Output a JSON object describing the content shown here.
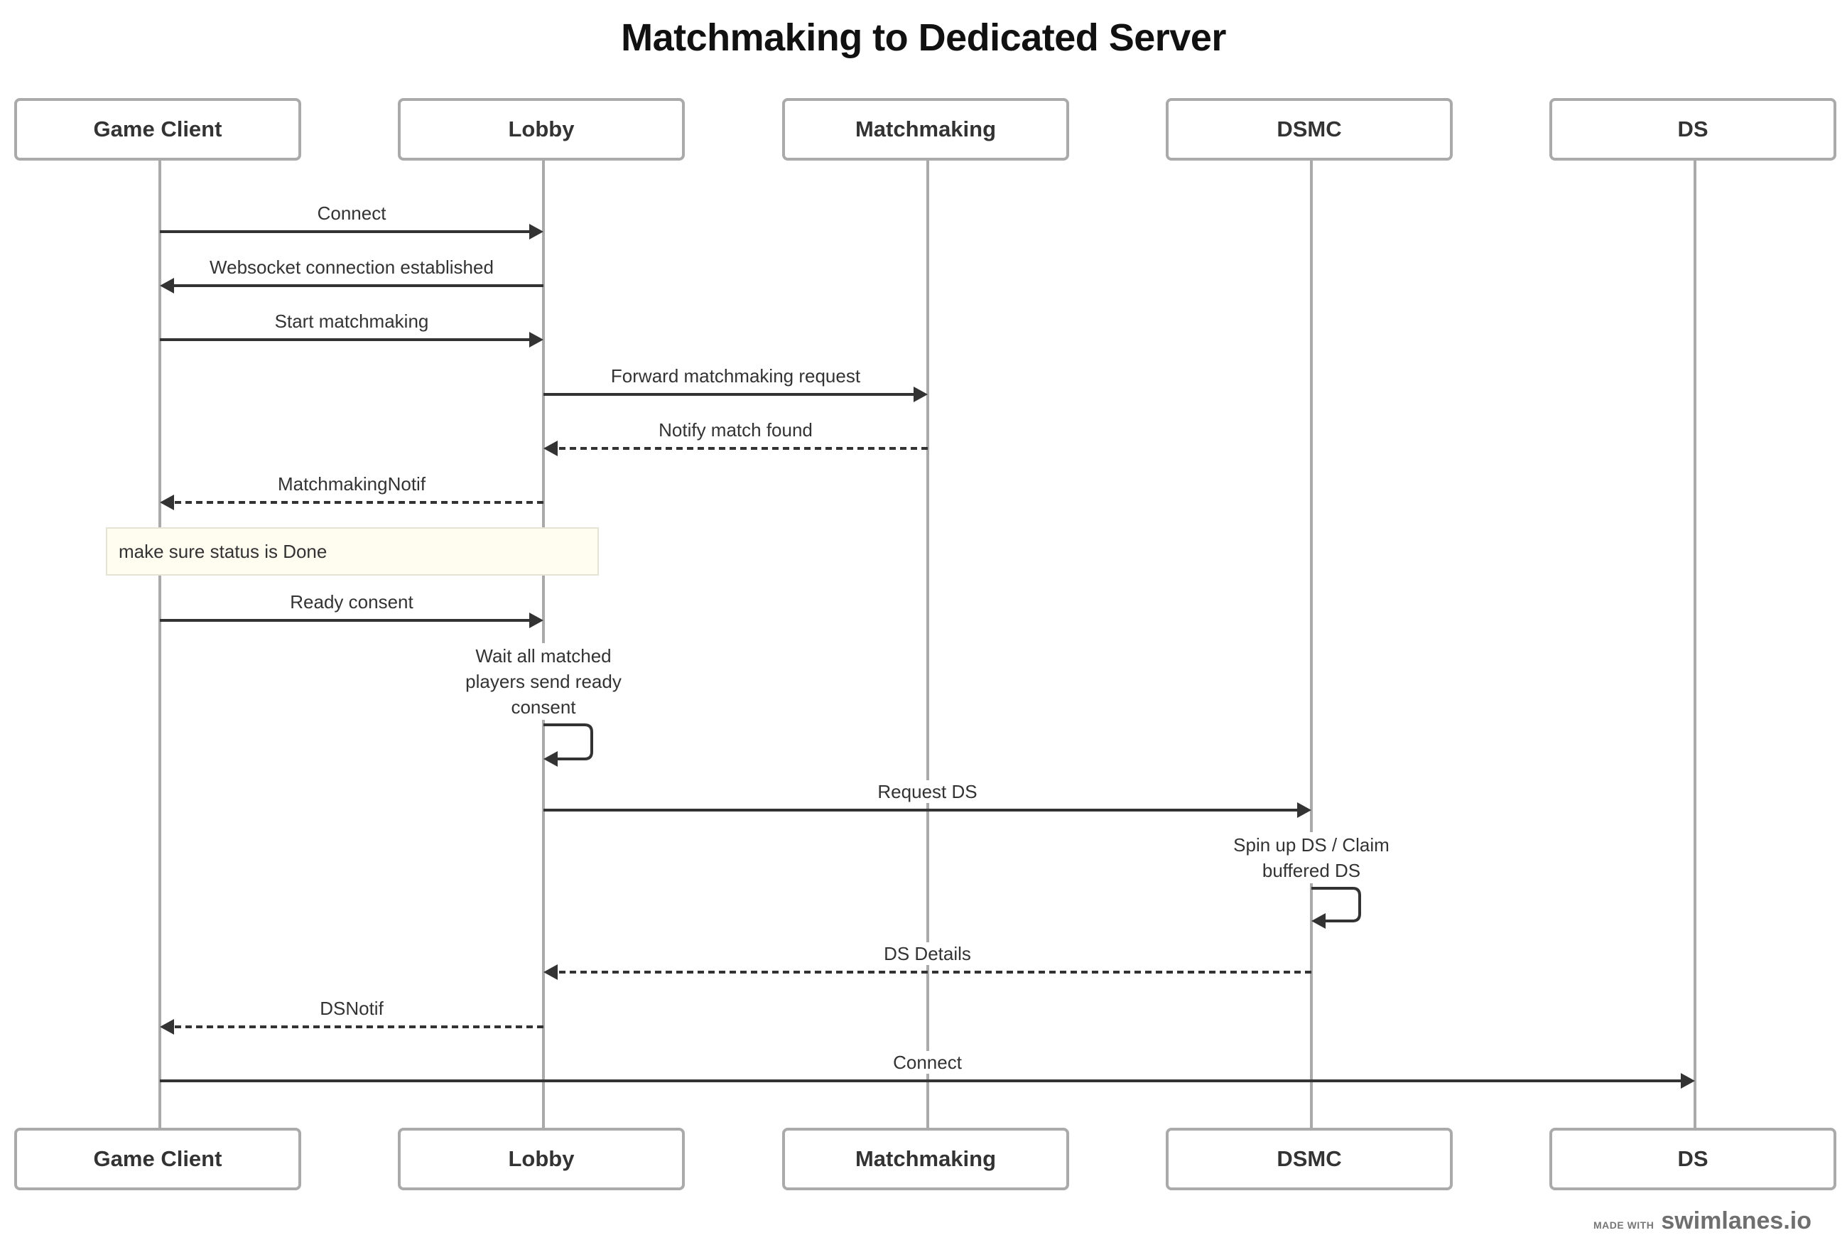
{
  "title": "Matchmaking to Dedicated Server",
  "actors": [
    {
      "id": "game-client",
      "label": "Game Client"
    },
    {
      "id": "lobby",
      "label": "Lobby"
    },
    {
      "id": "matchmaking",
      "label": "Matchmaking"
    },
    {
      "id": "dsmc",
      "label": "DSMC"
    },
    {
      "id": "ds",
      "label": "DS"
    }
  ],
  "steps": [
    {
      "type": "message",
      "from": 0,
      "to": 1,
      "label": "Connect",
      "style": "solid"
    },
    {
      "type": "message",
      "from": 1,
      "to": 0,
      "label": "Websocket connection established",
      "style": "solid"
    },
    {
      "type": "message",
      "from": 0,
      "to": 1,
      "label": "Start matchmaking",
      "style": "solid"
    },
    {
      "type": "message",
      "from": 1,
      "to": 2,
      "label": "Forward matchmaking request",
      "style": "solid"
    },
    {
      "type": "message",
      "from": 2,
      "to": 1,
      "label": "Notify match found",
      "style": "dashed"
    },
    {
      "type": "message",
      "from": 1,
      "to": 0,
      "label": "MatchmakingNotif",
      "style": "dashed"
    },
    {
      "type": "note",
      "over": [
        0,
        1
      ],
      "label": "make sure status is Done"
    },
    {
      "type": "message",
      "from": 0,
      "to": 1,
      "label": "Ready consent",
      "style": "solid"
    },
    {
      "type": "self",
      "actor": 1,
      "label": "Wait all matched players send ready consent",
      "lines": [
        "Wait all matched",
        "players send ready",
        "consent"
      ]
    },
    {
      "type": "message",
      "from": 1,
      "to": 3,
      "label": "Request DS",
      "style": "solid"
    },
    {
      "type": "self",
      "actor": 3,
      "label": "Spin up DS / Claim buffered DS",
      "lines": [
        "Spin up DS / Claim",
        "buffered DS"
      ]
    },
    {
      "type": "message",
      "from": 3,
      "to": 1,
      "label": "DS Details",
      "style": "dashed"
    },
    {
      "type": "message",
      "from": 1,
      "to": 0,
      "label": "DSNotif",
      "style": "dashed"
    },
    {
      "type": "message",
      "from": 0,
      "to": 4,
      "label": "Connect",
      "style": "solid"
    }
  ],
  "colors": {
    "lifeline": "#aaaaaa",
    "arrow": "#333333",
    "note_bg": "#fffdf0",
    "note_border": "#e5e3d3"
  },
  "footer": {
    "made_with": "MADE WITH",
    "brand": "swimlanes.io"
  }
}
